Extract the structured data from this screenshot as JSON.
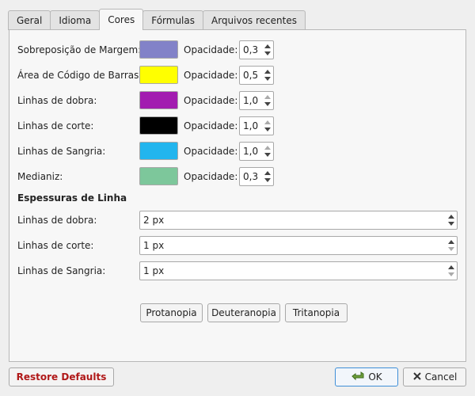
{
  "tabs": [
    {
      "label": "Geral"
    },
    {
      "label": "Idioma"
    },
    {
      "label": "Cores",
      "active": true
    },
    {
      "label": "Fórmulas"
    },
    {
      "label": "Arquivos recentes"
    }
  ],
  "colors": {
    "opacity_label": "Opacidade:",
    "rows": [
      {
        "label": "Sobreposição de Margem:",
        "color": "#8282c8",
        "opacity": "0,3"
      },
      {
        "label": "Área de Código de Barras:",
        "color": "#ffff00",
        "opacity": "0,5"
      },
      {
        "label": "Linhas de dobra:",
        "color": "#a21cb0",
        "opacity": "1,0"
      },
      {
        "label": "Linhas de corte:",
        "color": "#000000",
        "opacity": "1,0"
      },
      {
        "label": "Linhas de Sangria:",
        "color": "#22b5ee",
        "opacity": "1,0"
      },
      {
        "label": "Medianiz:",
        "color": "#7dc79b",
        "opacity": "0,3"
      }
    ]
  },
  "line_widths": {
    "title": "Espessuras de Linha",
    "rows": [
      {
        "label": "Linhas de dobra:",
        "value": "2 px"
      },
      {
        "label": "Linhas de corte:",
        "value": "1 px"
      },
      {
        "label": "Linhas de Sangria:",
        "value": "1 px"
      }
    ]
  },
  "colorblind_buttons": {
    "protanopia": "Protanopia",
    "deuteranopia": "Deuteranopia",
    "tritanopia": "Tritanopia"
  },
  "footer": {
    "restore": "Restore Defaults",
    "ok": "OK",
    "cancel": "Cancel"
  },
  "accent_colors": {
    "restore_text": "#b01818",
    "ok_border": "#3f8fd7"
  }
}
